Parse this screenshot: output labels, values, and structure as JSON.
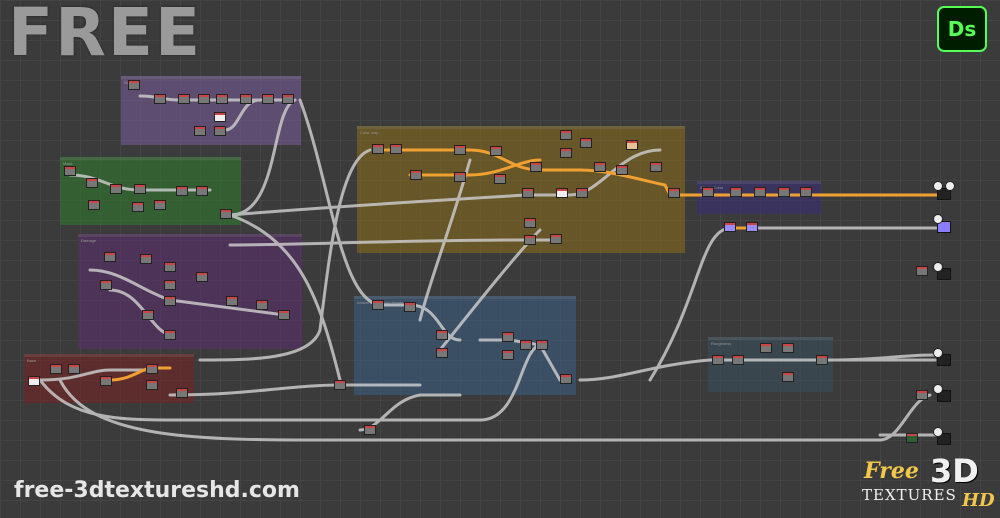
{
  "watermark": "FREE",
  "app_logo": {
    "label": "Ds",
    "icon": "substance-designer-logo-icon",
    "accent": "#55ff55"
  },
  "site_url": "free-3dtextureshd.com",
  "brand_logo": {
    "free": "Free",
    "three_d": "3D",
    "textures": "TEXTURES",
    "hd": "HD"
  },
  "frames": [
    {
      "id": "frame-purple-top",
      "title": "Bat",
      "color": "#7a5f9e"
    },
    {
      "id": "frame-green",
      "title": "Mask",
      "color": "#2e7d2e"
    },
    {
      "id": "frame-violet",
      "title": "Damage",
      "color": "#5b2e6e"
    },
    {
      "id": "frame-red",
      "title": "Base",
      "color": "#7a2222"
    },
    {
      "id": "frame-gold",
      "title": "Color map",
      "color": "#8a6d1a"
    },
    {
      "id": "frame-blue",
      "title": "Ambient Occlusion Height",
      "color": "#3a5f86"
    },
    {
      "id": "frame-indigo",
      "title": "Albedo Color",
      "color": "#3a2e7a"
    },
    {
      "id": "frame-slate",
      "title": "Roughness",
      "color": "#3a4f5e"
    }
  ]
}
